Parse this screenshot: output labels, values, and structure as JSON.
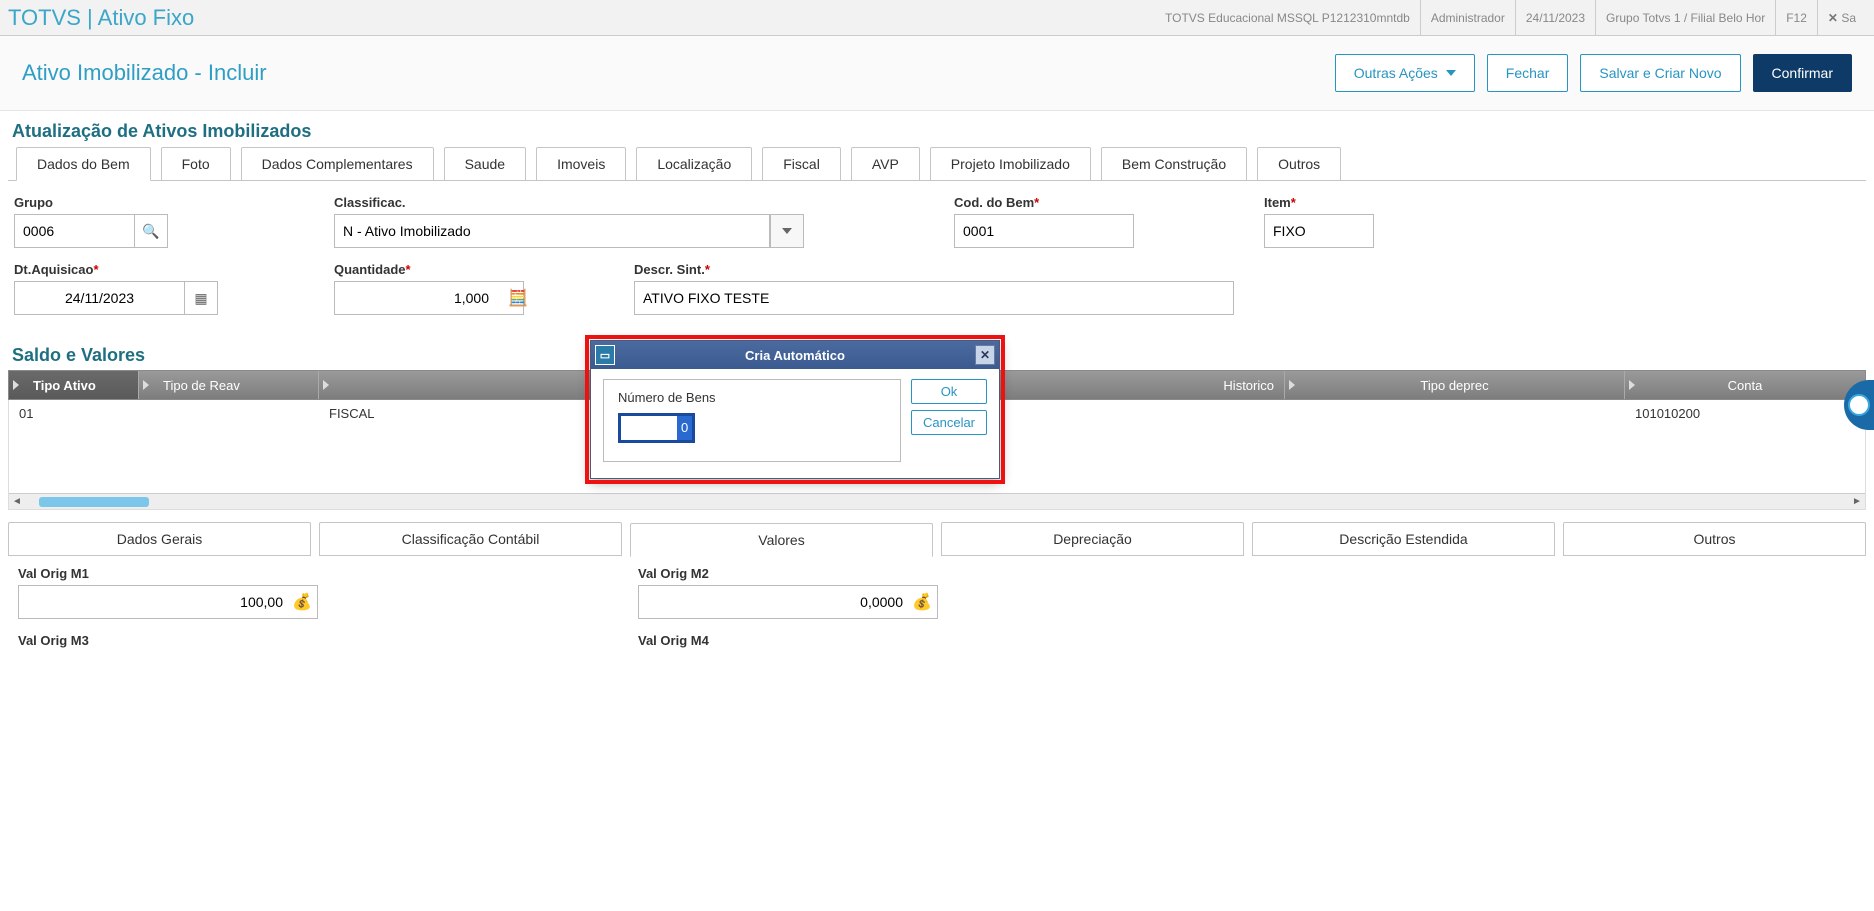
{
  "topbar": {
    "app_title": "TOTVS | Ativo Fixo",
    "env": "TOTVS Educacional MSSQL P1212310mntdb",
    "user": "Administrador",
    "date": "24/11/2023",
    "group": "Grupo Totvs 1 / Filial Belo Hor",
    "fkey": "F12",
    "close_hint": "Sa"
  },
  "actionbar": {
    "subtitle": "Ativo Imobilizado - Incluir",
    "other_actions": "Outras Ações",
    "close": "Fechar",
    "save_new": "Salvar e Criar Novo",
    "confirm": "Confirmar"
  },
  "section1_title": "Atualização de Ativos Imobilizados",
  "tabs": [
    "Dados do Bem",
    "Foto",
    "Dados Complementares",
    "Saude",
    "Imoveis",
    "Localização",
    "Fiscal",
    "AVP",
    "Projeto Imobilizado",
    "Bem Construção",
    "Outros"
  ],
  "form": {
    "grupo": {
      "label": "Grupo",
      "value": "0006"
    },
    "classificac": {
      "label": "Classificac.",
      "value": "N - Ativo Imobilizado"
    },
    "cod_bem": {
      "label": "Cod. do Bem",
      "value": "0001"
    },
    "item": {
      "label": "Item",
      "value": "FIXO"
    },
    "dt_aquisicao": {
      "label": "Dt.Aquisicao",
      "value": "24/11/2023"
    },
    "quantidade": {
      "label": "Quantidade",
      "value": "1,000"
    },
    "descr_sint": {
      "label": "Descr. Sint.",
      "value": "ATIVO FIXO TESTE"
    }
  },
  "section2_title": "Saldo e Valores",
  "grid": {
    "headers": [
      "Tipo Ativo",
      "Tipo de Reav",
      "Historico",
      "Tipo deprec",
      "Conta"
    ],
    "row": {
      "tipo_ativo": "01",
      "tipo_reav": "",
      "historico": "FISCAL",
      "tipo_deprec": "",
      "conta": "101010200"
    }
  },
  "subtabs": [
    "Dados Gerais",
    "Classificação Contábil",
    "Valores",
    "Depreciação",
    "Descrição Estendida",
    "Outros"
  ],
  "values": {
    "m1": {
      "label": "Val Orig M1",
      "value": "100,00"
    },
    "m2": {
      "label": "Val Orig M2",
      "value": "0,0000"
    },
    "m3": {
      "label": "Val Orig M3"
    },
    "m4": {
      "label": "Val Orig M4"
    }
  },
  "modal": {
    "title": "Cria Automático",
    "field_label": "Número de Bens",
    "value": "0",
    "ok": "Ok",
    "cancel": "Cancelar"
  }
}
